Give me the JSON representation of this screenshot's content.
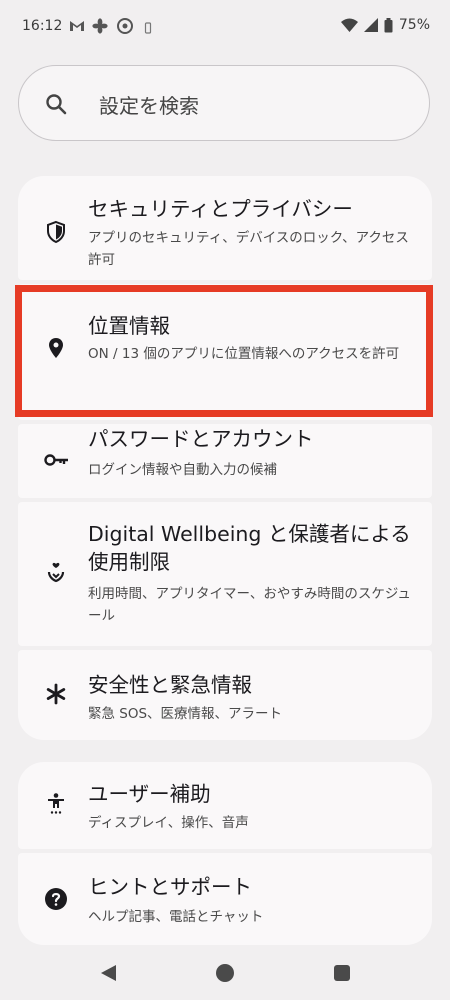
{
  "status_bar": {
    "time": "16:12",
    "notifications": [
      "gmail-icon",
      "fan-icon",
      "chrome-icon",
      "vibrate-icon"
    ],
    "battery": "75%"
  },
  "search": {
    "placeholder": "設定を検索"
  },
  "groups": [
    {
      "items": [
        {
          "icon": "shield-icon",
          "title": "セキュリティとプライバシー",
          "subtitle": "アプリのセキュリティ、デバイスのロック、アクセス許可"
        },
        {
          "icon": "location-pin-icon",
          "title": "位置情報",
          "subtitle": "ON / 13 個のアプリに位置情報へのアクセスを許可",
          "highlighted": true
        },
        {
          "icon": "key-icon",
          "title": "パスワードとアカウント",
          "subtitle": "ログイン情報や自動入力の候補"
        },
        {
          "icon": "wellbeing-icon",
          "title": "Digital Wellbeing と保護者による使用制限",
          "subtitle": "利用時間、アプリタイマー、おやすみ時間のスケジュール"
        },
        {
          "icon": "asterisk-icon",
          "title": "安全性と緊急情報",
          "subtitle": "緊急 SOS、医療情報、アラート"
        }
      ]
    },
    {
      "items": [
        {
          "icon": "accessibility-icon",
          "title": "ユーザー補助",
          "subtitle": "ディスプレイ、操作、音声"
        },
        {
          "icon": "help-icon",
          "title": "ヒントとサポート",
          "subtitle": "ヘルプ記事、電話とチャット"
        }
      ]
    }
  ],
  "colors": {
    "highlight": "#e63b25",
    "background": "#f1eff0",
    "card": "#faf8f9"
  }
}
